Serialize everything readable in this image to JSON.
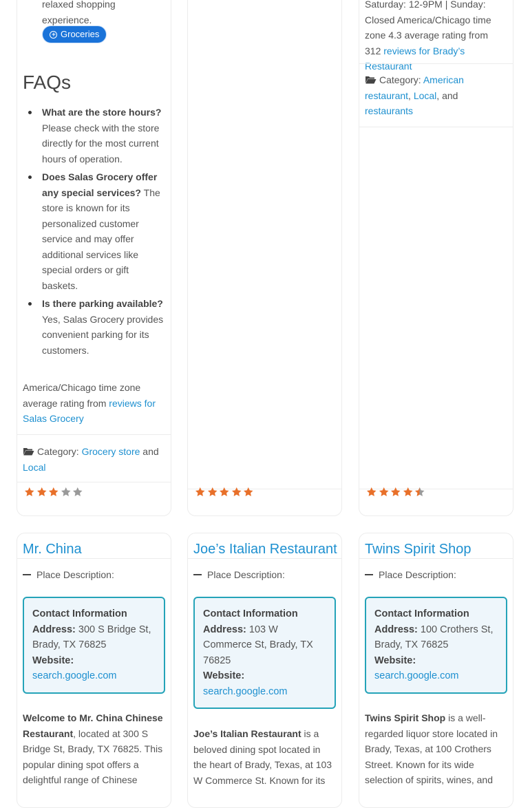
{
  "card1": {
    "snippet": "relaxed shopping experience.",
    "tag_label": "Groceries",
    "faq_title": "FAQs",
    "faqs": [
      {
        "q": "What are the store hours?",
        "a": "Please check with the store directly for the most current hours of operation."
      },
      {
        "q": "Does Salas Grocery offer any special services?",
        "a": "The store is known for its personalized customer service and may offer additional services like special orders or gift baskets."
      },
      {
        "q": "Is there parking available?",
        "a": "Yes, Salas Grocery provides convenient parking for its customers."
      }
    ],
    "meta_text": "America/Chicago time zone average rating from ",
    "meta_link": "reviews for Salas Grocery",
    "category_label": "Category:",
    "categories": [
      "Grocery store",
      "Local"
    ],
    "category_join": " and ",
    "rating": 3
  },
  "card2": {
    "rating": 5
  },
  "card3": {
    "meta_text": "Saturday: 12-9PM | Sunday: Closed America/Chicago time zone 4.3 average rating from 312 ",
    "meta_link": "reviews for Brady’s Restaurant",
    "category_label": "Category:",
    "categories": [
      "American restaurant",
      "Local",
      "restaurants"
    ],
    "rating": 4.5
  },
  "place_desc_label": "Place Description:",
  "contact_head": "Contact Information",
  "address_label": "Address:",
  "website_label": "Website:",
  "places": [
    {
      "title": "Mr. China",
      "address": "300 S Bridge St, Brady, TX 76825",
      "website": "search.google.com",
      "desc_bold": "Welcome to Mr. China Chinese Restaurant",
      "desc_text": ", located at 300 S Bridge St, Brady, TX 76825. This popular dining spot offers a delightful range of Chinese"
    },
    {
      "title": "Joe’s Italian Restaurant",
      "address": "103 W Commerce St, Brady, TX 76825",
      "website": "search.google.com",
      "desc_bold": "Joe’s Italian Restaurant",
      "desc_text": " is a beloved dining spot located in the heart of Brady, Texas, at 103 W Commerce St. Known for its"
    },
    {
      "title": "Twins Spirit Shop",
      "address": "100 Crothers St, Brady, TX 76825",
      "website": "search.google.com",
      "desc_bold": "Twins Spirit Shop",
      "desc_text": " is a well-regarded liquor store located in Brady, Texas, at 100 Crothers Street. Known for its wide selection of spirits, wines, and"
    }
  ],
  "colors": {
    "star": "#e8702a",
    "star_empty": "#9a9a9a",
    "link": "#1e90d0",
    "tag_bg": "#1a73d9",
    "contact_border": "#24a3b8"
  }
}
